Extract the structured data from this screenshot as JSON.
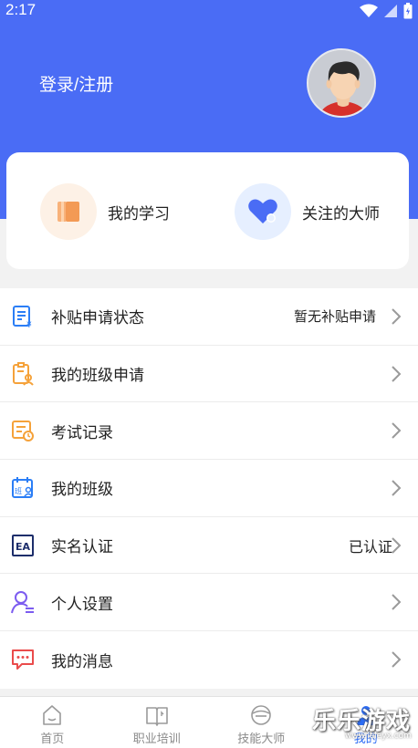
{
  "status_bar": {
    "time": "2:17"
  },
  "header": {
    "login_label": "登录/注册",
    "accent": "#4a6cf5"
  },
  "quick_actions": [
    {
      "label": "我的学习",
      "icon": "book-icon",
      "color": "#f5a25d"
    },
    {
      "label": "关注的大师",
      "icon": "heart-icon",
      "color": "#4a6cf5"
    }
  ],
  "menu": [
    {
      "label": "补贴申请状态",
      "value": "暂无补贴申请",
      "icon": "subsidy-doc-icon"
    },
    {
      "label": "我的班级申请",
      "value": "",
      "icon": "class-application-icon"
    },
    {
      "label": "考试记录",
      "value": "",
      "icon": "exam-record-icon"
    },
    {
      "label": "我的班级",
      "value": "",
      "icon": "class-calendar-icon"
    },
    {
      "label": "实名认证",
      "value": "已认证",
      "icon": "id-card-icon"
    },
    {
      "label": "个人设置",
      "value": "",
      "icon": "user-settings-icon"
    },
    {
      "label": "我的消息",
      "value": "",
      "icon": "message-icon"
    }
  ],
  "tabbar": [
    {
      "label": "首页",
      "icon": "home-icon",
      "active": false
    },
    {
      "label": "职业培训",
      "icon": "training-book-icon",
      "active": false
    },
    {
      "label": "技能大师",
      "icon": "master-icon",
      "active": false
    },
    {
      "label": "我的",
      "icon": "profile-icon",
      "active": true
    }
  ],
  "watermark": {
    "text": "乐乐游戏",
    "url": "www.leleyx.com"
  }
}
